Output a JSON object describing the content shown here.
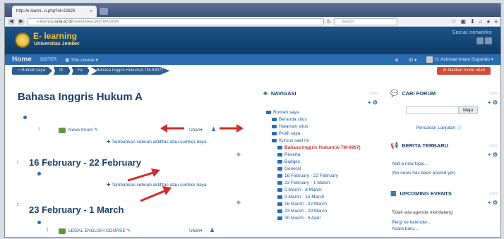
{
  "browser": {
    "tab_title": "http://e-learni...n.php?id=22826",
    "tab_close": "×",
    "url_prefix": "e-learning.",
    "url_host": "unej.ac.id",
    "url_path": "/course/view.php?id=22826",
    "search_placeholder": "Search"
  },
  "site": {
    "brand": "E- learning",
    "brand_sub": "Universitas Jember",
    "social_label": "Social networks"
  },
  "topnav": {
    "home": "Home",
    "sister": "SISTER",
    "this_course": "This course",
    "lang": "ID",
    "user": "H. Achmad Imam Sugondo"
  },
  "breadcrumb": [
    "Rumah saya",
    "IE",
    "Fa",
    "Bahasa Inggris Hukum(A TM-6907)"
  ],
  "edit_button": "Matikan mode ubah",
  "course": {
    "title": "Bahasa Inggris Hukum A",
    "news_forum": "News forum",
    "ubah": "Ubah",
    "add_activity": "Tambahkan sebuah aktifitas atau sumber daya",
    "section1_title": "16 February - 22 February",
    "section2_title": "23 February - 1 March",
    "legal_course": "LEGAL ENGLISH COURSE"
  },
  "navigasi": {
    "title": "NAVIGASI",
    "items": [
      {
        "label": "Rumah saya",
        "level": "l1"
      },
      {
        "label": "Beranda situs",
        "level": "l2"
      },
      {
        "label": "Halaman situs",
        "level": "l2"
      },
      {
        "label": "Profil saya",
        "level": "l2"
      },
      {
        "label": "Kursus saat ini",
        "level": "l2"
      },
      {
        "label": "Bahasa Inggris Hukum(A-TM-6907)",
        "level": "l3 current wrap"
      },
      {
        "label": "Peserta",
        "level": "l3"
      },
      {
        "label": "Badges",
        "level": "l3"
      },
      {
        "label": "General",
        "level": "l3"
      },
      {
        "label": "16 February - 22 February",
        "level": "l3 wrap"
      },
      {
        "label": "23 February - 1 March",
        "level": "l3"
      },
      {
        "label": "2 March - 8 March",
        "level": "l3"
      },
      {
        "label": "9 March - 15 March",
        "level": "l3"
      },
      {
        "label": "16 March - 22 March",
        "level": "l3"
      },
      {
        "label": "23 March - 29 March",
        "level": "l3"
      },
      {
        "label": "30 March - 5 April",
        "level": "l3"
      }
    ]
  },
  "cari_forum": {
    "title": "CARI FORUM",
    "maju": "Maju",
    "advanced": "Pencarian Lanjutan"
  },
  "berita": {
    "title": "BERITA TERBARU",
    "add_topic": "Add a new topic...",
    "no_news": "(No news has been posted yet)"
  },
  "events": {
    "title": "UPCOMING EVENTS",
    "none": "Tidak ada agenda mendatang",
    "goto_calendar": "Pergi ke kalender...",
    "new_event": "Acara baru..."
  },
  "colors": {
    "accent": "#2a6cb0",
    "header": "#1b5488",
    "edit_red": "#d24c3a",
    "arrow_red": "#d42a2a"
  }
}
